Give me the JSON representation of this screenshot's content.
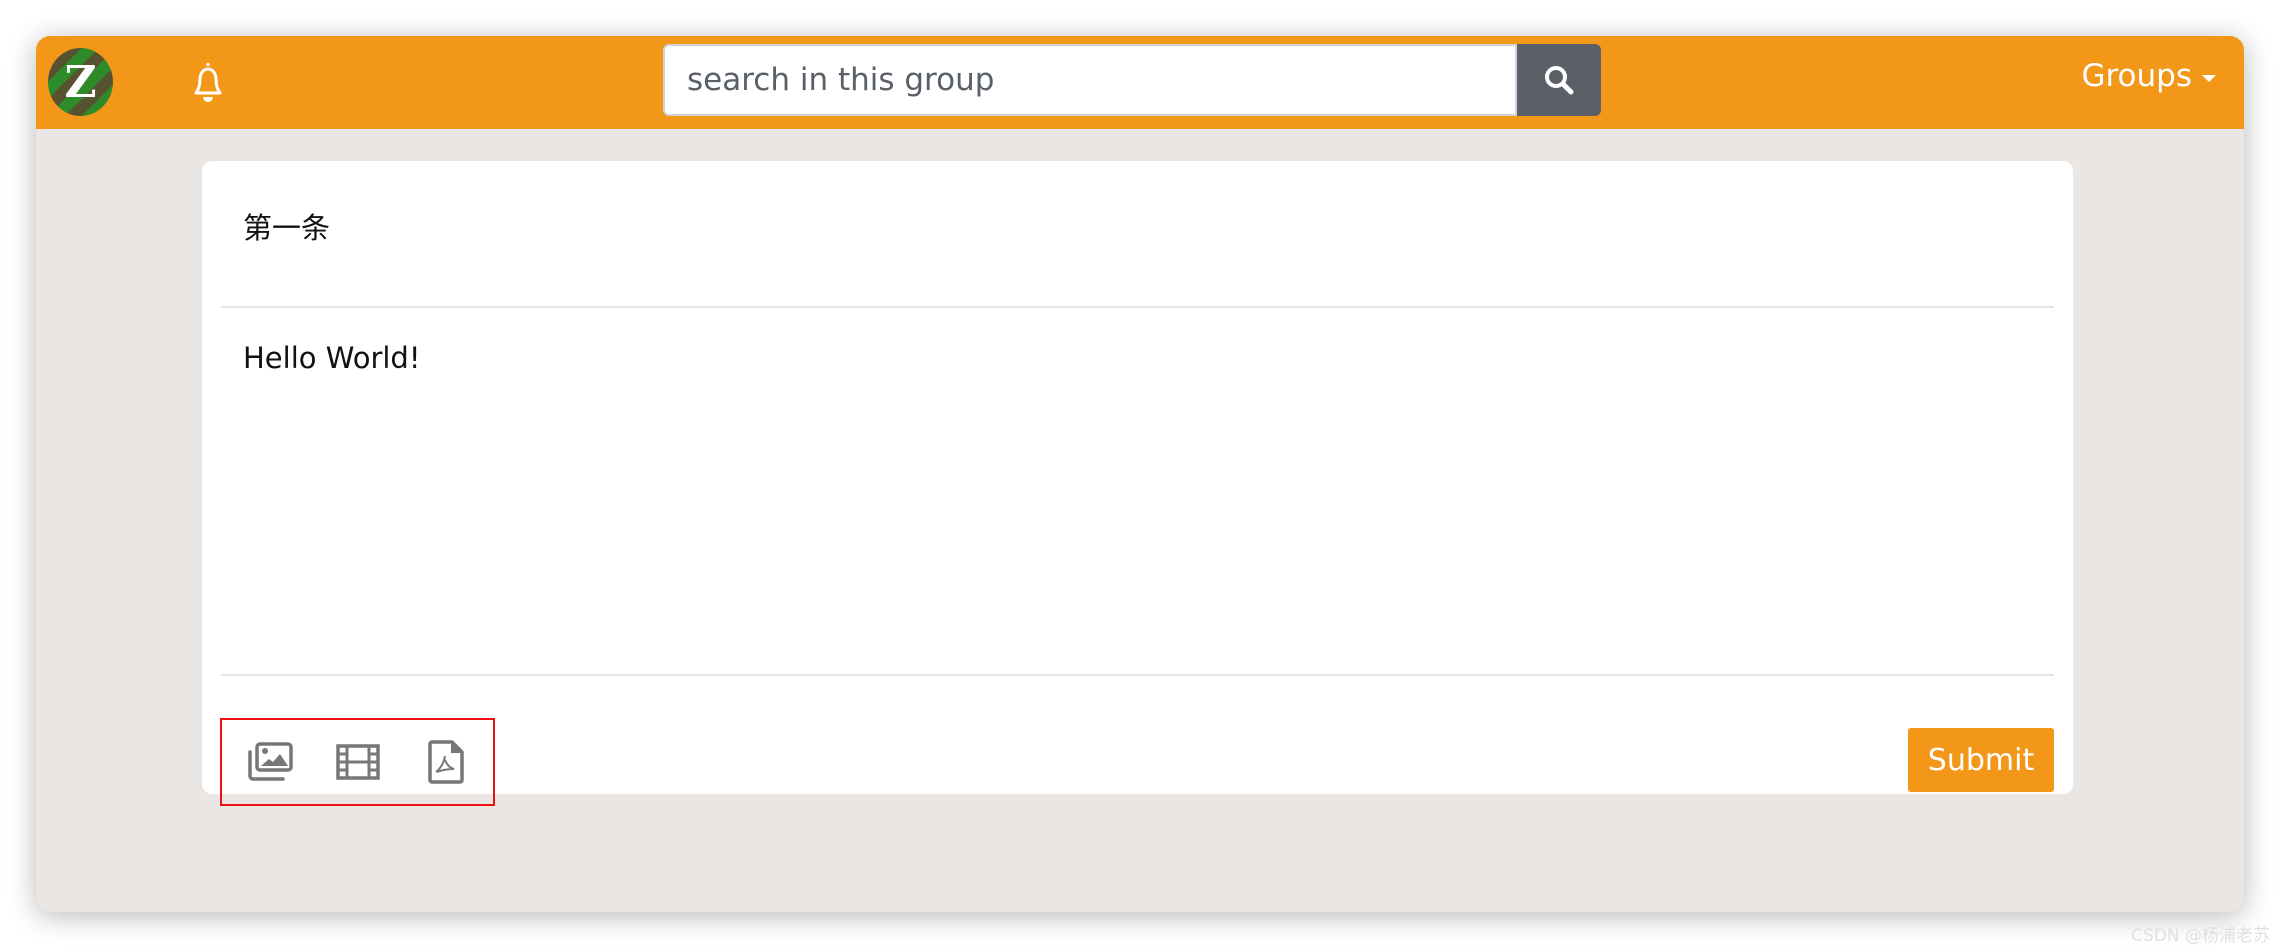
{
  "header": {
    "logo_letter": "Z",
    "search_placeholder": "search in this group",
    "groups_label": "Groups"
  },
  "post": {
    "title": "第一条",
    "content": "Hello World!",
    "attachments": [
      {
        "icon": "images-icon"
      },
      {
        "icon": "film-icon"
      },
      {
        "icon": "pdf-file-icon"
      }
    ],
    "submit_label": "Submit"
  },
  "watermark": "CSDN @杨浦老苏",
  "colors": {
    "accent": "#f39719",
    "search_button": "#5b6068",
    "background": "#e9e6e3",
    "highlight_box": "#ee1111"
  }
}
